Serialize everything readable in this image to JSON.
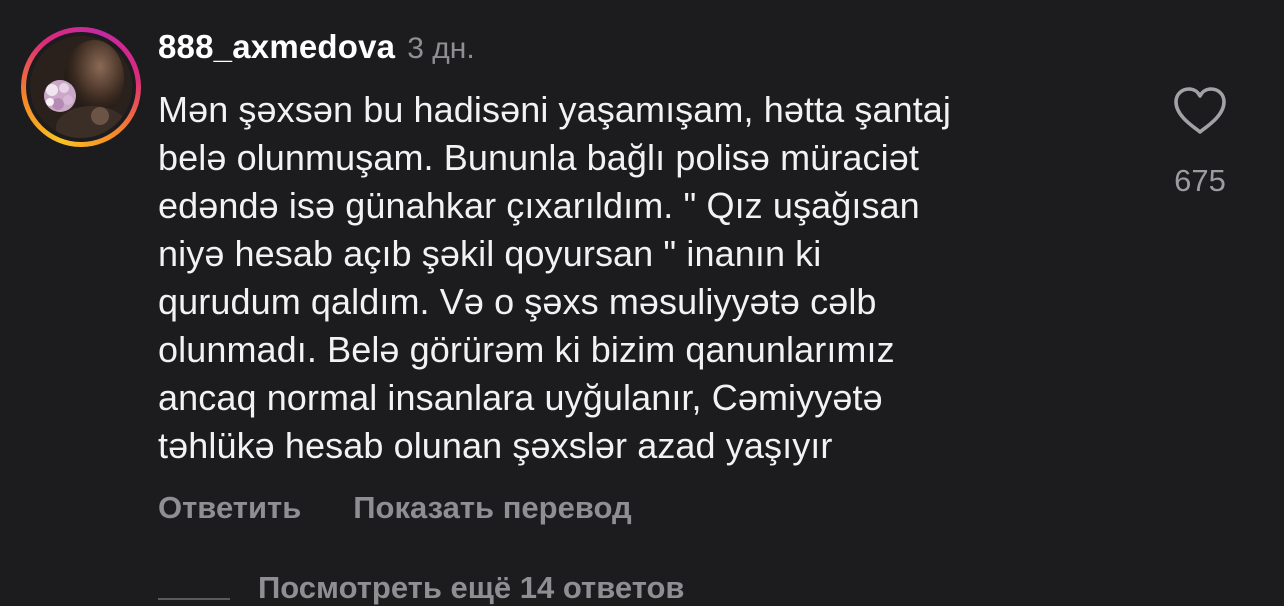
{
  "comment": {
    "username": "888_axmedova",
    "time": "3 дн.",
    "text": "Mən şəxsən bu hadisəni yaşamışam, hətta şantaj\nbelə olunmuşam. Bununla bağlı polisə müraciət\nedəndə isə günahkar çıxarıldım. \" Qız uşağısan\nniyə hesab açıb şəkil qoyursan \" inanın ki\nqurudum qaldım. Və o şəxs məsuliyyətə cəlb\nolunmadı. Belə görürəm ki bizim qanunlarımız\nancaq normal insanlara uyğulanır, Cəmiyyətə\ntəhlükə hesab olunan şəxslər azad yaşıyır",
    "like_icon": "heart-outline-icon",
    "like_count": "675",
    "reply_label": "Ответить",
    "translate_label": "Показать перевод",
    "view_replies_label": "Посмотреть ещё 14 ответов"
  },
  "colors": {
    "background": "#1c1c1e",
    "text_primary": "#ffffff",
    "text_secondary": "#8e8e93",
    "story_ring_start": "#f9c423",
    "story_ring_end": "#dd2a7b"
  }
}
